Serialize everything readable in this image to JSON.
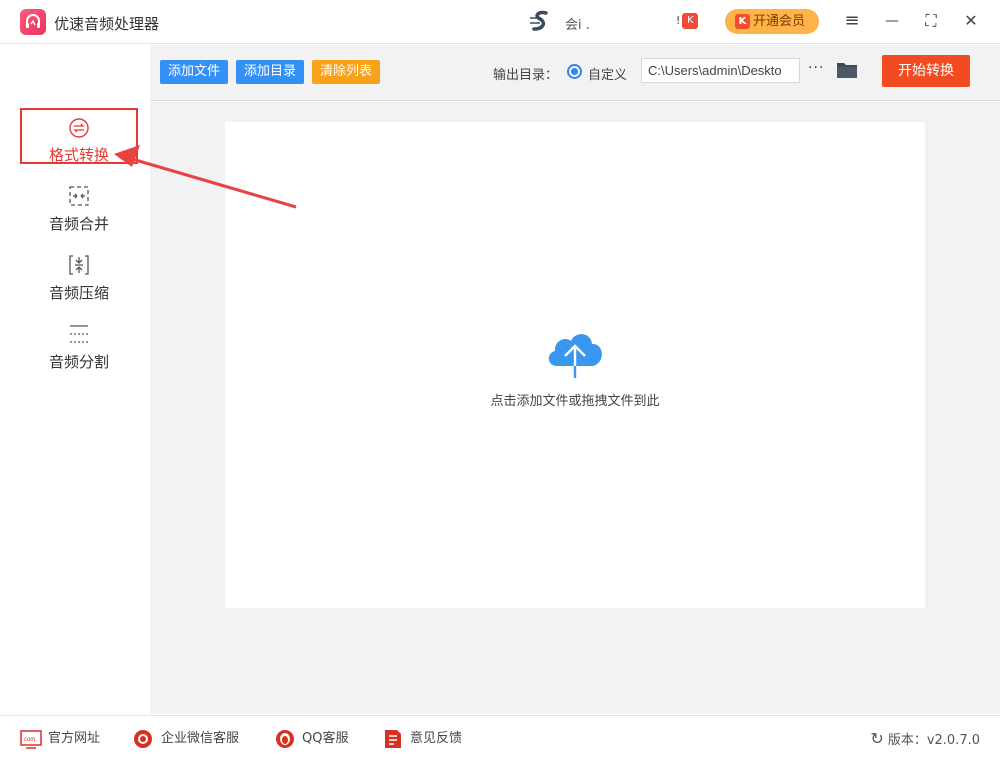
{
  "app": {
    "title": "优速音频处理器"
  },
  "header": {
    "user_name": "会i .",
    "vip_label": "开通会员",
    "mini_badge_mark": "!"
  },
  "window_controls": {
    "menu": "≡",
    "minimize": "—",
    "maximize": "⛶",
    "close": "✕"
  },
  "sidebar": {
    "items": [
      {
        "label": "格式转换",
        "icon": "convert-icon",
        "active": true
      },
      {
        "label": "音频合并",
        "icon": "merge-icon",
        "active": false
      },
      {
        "label": "音频压缩",
        "icon": "compress-icon",
        "active": false
      },
      {
        "label": "音频分割",
        "icon": "split-icon",
        "active": false
      }
    ]
  },
  "toolbar": {
    "add_file": "添加文件",
    "add_dir": "添加目录",
    "clear_list": "清除列表",
    "output_label": "输出目录：",
    "custom_label": "自定义",
    "output_path": "C:\\Users\\admin\\Deskto",
    "more": "···",
    "start": "开始转换"
  },
  "dropzone": {
    "hint": "点击添加文件或拖拽文件到此"
  },
  "footer": {
    "website": "官方网址",
    "wechat_service": "企业微信客服",
    "qq_service": "QQ客服",
    "feedback": "意见反馈",
    "version": "版本：v2.0.7.0"
  },
  "colors": {
    "accent_red": "#e53935",
    "primary_blue": "#3590f5",
    "orange": "#f7a21b",
    "start_red": "#f24a21",
    "vip_orange": "#ffb348"
  }
}
